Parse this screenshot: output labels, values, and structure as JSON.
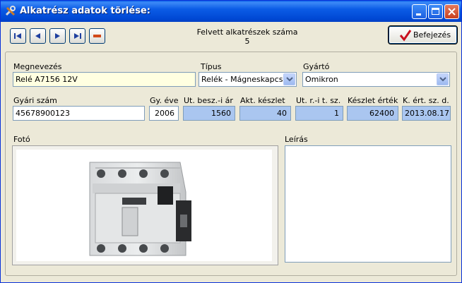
{
  "window": {
    "title": "Alkatrész adatok törlése:"
  },
  "toolbar": {
    "record_count_label": "Felvett alkatrészek száma",
    "record_count": "5",
    "finish_label": "Befejezés"
  },
  "form": {
    "name_label": "Megnevezés",
    "name_value": "Relé A7156 12V",
    "type_label": "Típus",
    "type_value": "Relék - Mágneskapcs.",
    "manufacturer_label": "Gyártó",
    "manufacturer_value": "Omikron",
    "serial_label": "Gyári szám",
    "serial_value": "45678900123",
    "year_label": "Gy. éve",
    "year_value": "2006",
    "last_price_label": "Ut. besz.-i ár",
    "last_price_value": "1560",
    "stock_label": "Akt. készlet",
    "stock_value": "40",
    "last_order_label": "Ut. r.-i t. sz.",
    "last_order_value": "1",
    "stock_value_label": "Készlet érték",
    "stock_value_value": "62400",
    "stock_date_label": "K. ért. sz. d.",
    "stock_date_value": "2013.08.17",
    "photo_label": "Fotó",
    "description_label": "Leírás"
  },
  "colors": {
    "titlebar": "#0054e3",
    "window_bg": "#ece9d8",
    "readonly_field": "#aac6f0",
    "name_field": "#ffffe1"
  }
}
